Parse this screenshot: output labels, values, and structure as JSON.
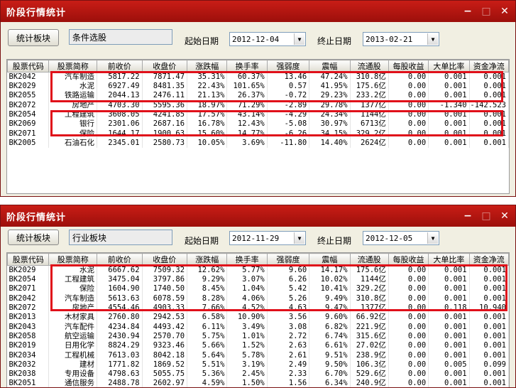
{
  "colors": {
    "title_bar": "#b5150f",
    "highlight": "#e0101a"
  },
  "window1": {
    "title": "阶段行情统计",
    "controls": {
      "minimize": "−",
      "maximize": "□",
      "close": "✕"
    },
    "sector_button": "统计板块",
    "mode_value": "条件选股",
    "start_label": "起始日期",
    "start_date": "2012-12-04",
    "end_label": "终止日期",
    "end_date": "2013-02-21",
    "columns": [
      "股票代码",
      "股票简称",
      "前收价",
      "收盘价",
      "涨跌幅",
      "换手率",
      "强弱度",
      "震幅",
      "流通股",
      "每股收益",
      "大单比率",
      "资金净流"
    ],
    "rows": [
      [
        "BK2042",
        "汽车制造",
        "5817.22",
        "7871.47",
        "35.31%",
        "60.37%",
        "13.46",
        "47.24%",
        "310.8亿",
        "0.00",
        "0.001",
        "0.001"
      ],
      [
        "BK2029",
        "水泥",
        "6927.49",
        "8481.35",
        "22.43%",
        "101.65%",
        "0.57",
        "41.95%",
        "175.6亿",
        "0.00",
        "0.001",
        "0.001"
      ],
      [
        "BK2055",
        "铁路运输",
        "2044.13",
        "2476.11",
        "21.13%",
        "26.37%",
        "-0.72",
        "29.23%",
        "233.2亿",
        "0.00",
        "0.001",
        "0.001"
      ],
      [
        "BK2072",
        "房地产",
        "4703.30",
        "5595.36",
        "18.97%",
        "71.29%",
        "-2.89",
        "29.78%",
        "1377亿",
        "0.00",
        "-1.340",
        "-142.523"
      ],
      [
        "BK2054",
        "工程建筑",
        "3608.05",
        "4241.85",
        "17.57%",
        "43.14%",
        "-4.29",
        "24.34%",
        "1144亿",
        "0.00",
        "0.001",
        "0.001"
      ],
      [
        "BK2069",
        "银行",
        "2301.06",
        "2687.16",
        "16.78%",
        "12.43%",
        "-5.08",
        "30.97%",
        "6713亿",
        "0.00",
        "0.001",
        "0.001"
      ],
      [
        "BK2071",
        "保险",
        "1644.17",
        "1900.63",
        "15.60%",
        "14.77%",
        "-6.26",
        "34.15%",
        "329.2亿",
        "0.00",
        "0.001",
        "0.001"
      ],
      [
        "BK2005",
        "石油石化",
        "2345.01",
        "2580.73",
        "10.05%",
        "3.69%",
        "-11.80",
        "14.40%",
        "2624亿",
        "0.00",
        "0.001",
        "0.001"
      ]
    ]
  },
  "window2": {
    "title": "阶段行情统计",
    "controls": {
      "minimize": "−",
      "maximize": "□",
      "close": "✕"
    },
    "sector_button": "统计板块",
    "mode_value": "行业板块",
    "start_label": "起始日期",
    "start_date": "2012-11-29",
    "end_label": "终止日期",
    "end_date": "2012-12-05",
    "columns": [
      "股票代码",
      "股票简称",
      "前收价",
      "收盘价",
      "涨跌幅",
      "换手率",
      "强弱度",
      "震幅",
      "流通股",
      "每股收益",
      "大单比率",
      "资金净流"
    ],
    "rows": [
      [
        "BK2029",
        "水泥",
        "6667.62",
        "7509.32",
        "12.62%",
        "5.77%",
        "9.60",
        "14.17%",
        "175.6亿",
        "0.00",
        "0.001",
        "0.001"
      ],
      [
        "BK2054",
        "工程建筑",
        "3475.04",
        "3797.86",
        "9.29%",
        "3.07%",
        "6.26",
        "10.02%",
        "1144亿",
        "0.00",
        "0.001",
        "0.001"
      ],
      [
        "BK2071",
        "保险",
        "1604.90",
        "1740.50",
        "8.45%",
        "1.04%",
        "5.42",
        "10.41%",
        "329.2亿",
        "0.00",
        "0.001",
        "0.001"
      ],
      [
        "BK2042",
        "汽车制造",
        "5613.63",
        "6078.59",
        "8.28%",
        "4.06%",
        "5.26",
        "9.49%",
        "310.8亿",
        "0.00",
        "0.001",
        "0.001"
      ],
      [
        "BK2072",
        "房地产",
        "4554.46",
        "4903.33",
        "7.66%",
        "4.52%",
        "4.63",
        "9.47%",
        "1377亿",
        "0.00",
        "0.118",
        "10.940"
      ],
      [
        "BK2013",
        "木材家具",
        "2760.80",
        "2942.53",
        "6.58%",
        "10.90%",
        "3.56",
        "9.60%",
        "66.92亿",
        "0.00",
        "0.001",
        "0.001"
      ],
      [
        "BK2043",
        "汽车配件",
        "4234.84",
        "4493.42",
        "6.11%",
        "3.49%",
        "3.08",
        "6.82%",
        "221.9亿",
        "0.00",
        "0.001",
        "0.001"
      ],
      [
        "BK2058",
        "航空运输",
        "2430.94",
        "2570.70",
        "5.75%",
        "1.01%",
        "2.72",
        "6.74%",
        "315.6亿",
        "0.00",
        "0.001",
        "0.001"
      ],
      [
        "BK2019",
        "日用化学",
        "8824.29",
        "9323.46",
        "5.66%",
        "1.52%",
        "2.63",
        "6.61%",
        "27.02亿",
        "0.00",
        "0.001",
        "0.001"
      ],
      [
        "BK2034",
        "工程机械",
        "7613.03",
        "8042.18",
        "5.64%",
        "5.78%",
        "2.61",
        "9.51%",
        "238.9亿",
        "0.00",
        "0.001",
        "0.001"
      ],
      [
        "BK2032",
        "建材",
        "1771.82",
        "1869.52",
        "5.51%",
        "3.19%",
        "2.49",
        "9.50%",
        "106.3亿",
        "0.00",
        "0.005",
        "0.099"
      ],
      [
        "BK2038",
        "专用设备",
        "4798.63",
        "5055.75",
        "5.36%",
        "2.45%",
        "2.33",
        "6.70%",
        "529.6亿",
        "0.00",
        "0.001",
        "0.001"
      ],
      [
        "BK2051",
        "通信服务",
        "2488.78",
        "2602.97",
        "4.59%",
        "1.50%",
        "1.56",
        "6.34%",
        "240.9亿",
        "0.00",
        "0.001",
        "0.001"
      ]
    ]
  }
}
